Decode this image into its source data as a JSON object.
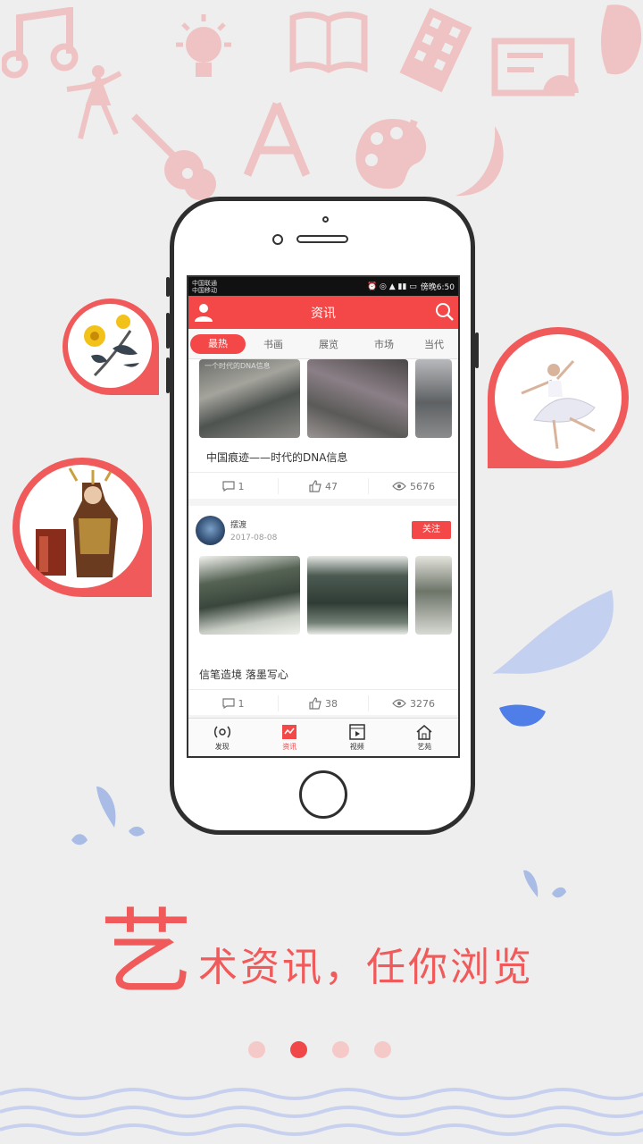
{
  "status_bar": {
    "carrier_1": "中国联通",
    "carrier_2": "中国移动",
    "time": "傍晚6:50"
  },
  "app_bar": {
    "title": "资讯"
  },
  "tabs": [
    {
      "label": "最热",
      "active": true
    },
    {
      "label": "书画",
      "active": false
    },
    {
      "label": "展览",
      "active": false
    },
    {
      "label": "市场",
      "active": false
    },
    {
      "label": "当代",
      "active": false
    }
  ],
  "feed": {
    "card_1": {
      "overlay_text": "一个时代的DNA信息",
      "title": "中国痕迹——时代的DNA信息",
      "comments": "1",
      "likes": "47",
      "views": "5676"
    },
    "card_2": {
      "author": "摆渡",
      "date": "2017-08-08",
      "follow_label": "关注",
      "title": "信笔造境  落墨写心",
      "comments": "1",
      "likes": "38",
      "views": "3276"
    }
  },
  "bottom_nav": [
    {
      "label": "发现",
      "icon": "radar-icon",
      "active": false
    },
    {
      "label": "资讯",
      "icon": "news-icon",
      "active": true
    },
    {
      "label": "视频",
      "icon": "video-icon",
      "active": false
    },
    {
      "label": "艺苑",
      "icon": "home-icon",
      "active": false
    }
  ],
  "tagline": {
    "big_char": "艺",
    "rest": "术资讯，任你浏览"
  },
  "pager": {
    "count": 4,
    "active_index": 1
  },
  "colors": {
    "accent": "#f44848",
    "doodle": "#f5c3c3",
    "water": "#4f7ee8"
  }
}
